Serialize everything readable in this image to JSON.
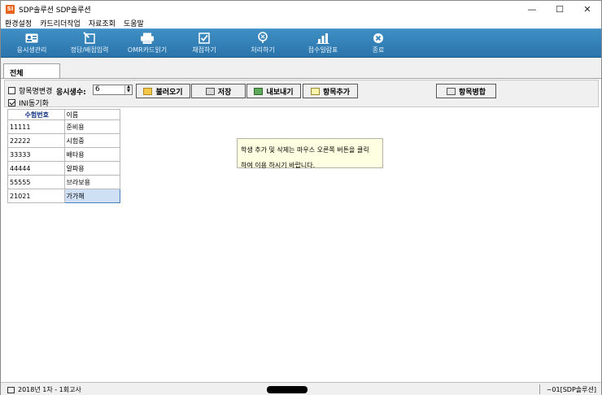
{
  "window": {
    "title": "SDP솔루션 SDP솔루션",
    "icon_text": "SI",
    "controls": {
      "minimize": "—",
      "maximize": "☐",
      "close": "✕"
    }
  },
  "menu": [
    "환경설정",
    "카드리더작업",
    "자료조회",
    "도움말"
  ],
  "toolbar": [
    {
      "label": "응시생관리",
      "icon": "id-card-icon"
    },
    {
      "label": "정답/배점입력",
      "icon": "edit-sheet-icon"
    },
    {
      "label": "OMR카드읽기",
      "icon": "printer-icon"
    },
    {
      "label": "채점하기",
      "icon": "checkmark-icon"
    },
    {
      "label": "처리하기",
      "icon": "process-icon"
    },
    {
      "label": "점수일람표",
      "icon": "bar-chart-icon"
    },
    {
      "label": "종료",
      "icon": "close-circle-icon"
    }
  ],
  "tabs": [
    "전체"
  ],
  "controls": {
    "rename_items_label": "항목명변경",
    "rename_items_checked": false,
    "ini_sync_label": "INI동기화",
    "ini_sync_checked": true,
    "count_label": "응시생수:",
    "count_value": "6",
    "load_button": "불러오기",
    "save_button": "저장",
    "export_button": "내보내기",
    "add_item_button": "항목추가",
    "merge_items_button": "항목병합"
  },
  "grid": {
    "columns": [
      "수험번호",
      "이름"
    ],
    "rows": [
      [
        "11111",
        "준비용"
      ],
      [
        "22222",
        "시험중"
      ],
      [
        "33333",
        "배타용"
      ],
      [
        "44444",
        "알파용"
      ],
      [
        "55555",
        "브라보용"
      ],
      [
        "21021",
        "가가해"
      ]
    ]
  },
  "tooltip": {
    "line1": "학생 추가 및 삭제는 마우스 오른쪽 버튼을 클릭",
    "line2": "하여 이용 하시기 바랍니다."
  },
  "status": {
    "left": "2018년 1차 - 1회고사",
    "right": "~01[SDP솔루션]"
  },
  "colors": {
    "toolbar_bg": "#2f7db4",
    "tooltip_bg": "#ffffe1",
    "selected_cell": "#cfe0f5"
  }
}
